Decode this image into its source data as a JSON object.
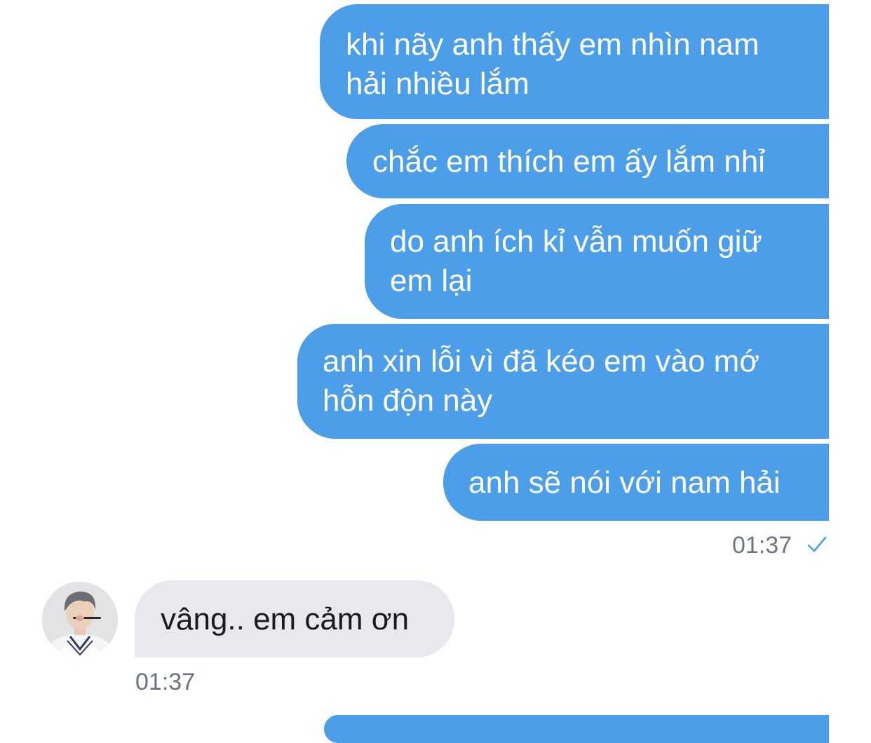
{
  "messages": [
    {
      "direction": "outgoing",
      "text": "khi nãy anh thấy em nhìn nam\nhải nhiều lắm"
    },
    {
      "direction": "outgoing",
      "text": "chắc em thích em ấy lắm nhỉ"
    },
    {
      "direction": "outgoing",
      "text": "do anh ích kỉ vẫn muốn giữ\nem lại"
    },
    {
      "direction": "outgoing",
      "text": "anh xin lỗi vì đã kéo em vào mớ\nhỗn độn này"
    },
    {
      "direction": "outgoing",
      "text": "anh sẽ nói với nam hải"
    },
    {
      "direction": "incoming",
      "text": "vâng.. em cảm ơn"
    }
  ],
  "timestamps": {
    "outgoing_group": "01:37",
    "incoming_group": "01:37"
  },
  "icons": {
    "read_receipt": "checkmark-icon",
    "contact_avatar": "avatar"
  },
  "colors": {
    "outgoing_bubble": "#4c9ee8",
    "incoming_bubble": "#e7e9ef",
    "outgoing_text": "#ffffff",
    "incoming_text": "#1b1b1b",
    "timestamp": "#6c7480",
    "check": "#4c9ee8"
  }
}
